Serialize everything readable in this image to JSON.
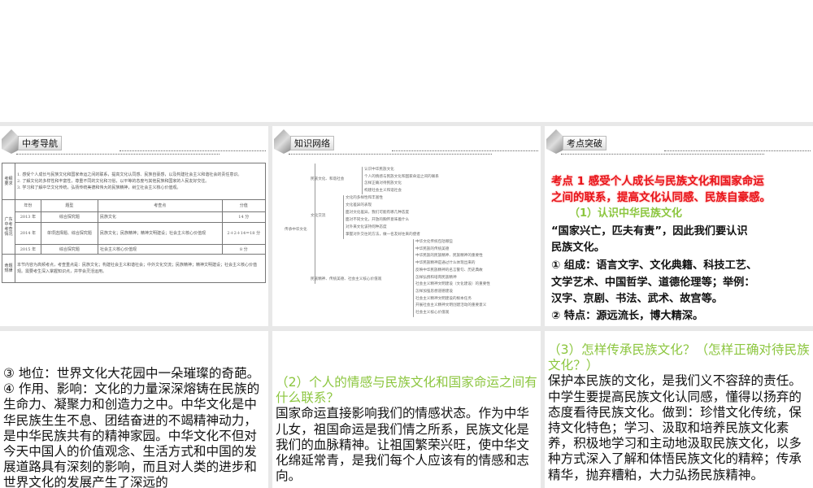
{
  "slide1": {
    "header": "中考导航",
    "req_label": "考纲要求",
    "requirements": [
      "1. 感受个人成长与民族文化和国家命运之间的联系，提高文化认同感、民族自豪感，以及构建社会主义和谐社会的责任意识。",
      "2. 了解文化的多样性和丰富性，尊重不同的文化和习俗，以平等的态度与其他民族和国家的人民友好交往。",
      "3. 学习和了解中华文化传统，弘扬传统美德和伟大的民族精神，树立社会主义核心价值观。"
    ],
    "exam_label": "广东中考考查情况",
    "columns": [
      "年份",
      "题型",
      "考查点",
      "分值"
    ],
    "rows": [
      [
        "2013 年",
        "综合探究题",
        "民族文化",
        "14 分"
      ],
      [
        "2014 年",
        "单项选择题、综合探究题",
        "民族文化；民族精神；精神文明建设；社会主义核心价值观",
        "2＋2＋14＝18 分"
      ],
      [
        "2015 年",
        "综合探究题",
        "社会主义核心价值观",
        "8 分"
      ]
    ],
    "rule_label": "命题规律",
    "rule": "本节内容为高频考点，考查重点是：民族文化；构建社会主义和谐社会；中外文化交流；民族精神；精神文明建设；社会主义核心价值观。需要考生深入掌握知识点，并学会灵活运用。"
  },
  "slide2": {
    "header": "知识网络",
    "root": "传承中华文化",
    "branches": [
      {
        "label": "民族文化、和谐社会",
        "items": [
          "认识中华民族文化",
          "个人的情感与民族文化和国家命运之间的联系",
          "怎样正确对待民族文化",
          "构建社会主义和谐社会"
        ]
      },
      {
        "label": "文化交流",
        "items": [
          "文化的多样性和丰富性",
          "文化差异的表现",
          "面对文化差异，我们可能有哪几种态度",
          "面对不同文化，开放的胸怀意味着什么",
          "对外来文化该持何种态度",
          "掌握对外交往的方法，做一名友好往来的使者"
        ]
      },
      {
        "label": "民族精神、传统美德、社会主义核心价值观",
        "items": [
          "中华文化传统包括哪些",
          "中华民族的传统美德",
          "中华民族的民族精神、民族精神的重要性",
          "中华民族精神是通过什么体现出来的",
          "反映中华民族精神的名言警句、历史典故",
          "怎样弘扬和培育民族精神",
          "社会主义精神文明建设（文化建设）的重要性",
          "怎样加强思想道德建设",
          "社会主义精神文明建设的根本任务",
          "开展社会主义精神文明创建活动的重要意义",
          "社会主义核心价值观"
        ]
      }
    ]
  },
  "slide3": {
    "header": "考点突破",
    "topic": [
      "考点 1 感受个人成长与民族文化和国家命运",
      "之间的联系，提高文化认同感、民族自豪感。"
    ],
    "subhead": "（1）认识中华民族文化",
    "lines": [
      "“国家兴亡，匹夫有责”，因此我们要认识",
      "民族文化。",
      "① 组成：语言文字、文化典籍、科技工艺、",
      "文学艺术、中国哲学、道德伦理等；举例：",
      "汉字、京剧、书法、武术、故宫等。",
      "② 特点：源远流长，博大精深。"
    ]
  },
  "slide4": {
    "text": "③ 地位：世界文化大花园中一朵璀璨的奇葩。④ 作用、影响：文化的力量深深熔铸在民族的生命力、凝聚力和创造力之中。中华文化是中华民族生生不息、团结奋进的不竭精神动力，是中华民族共有的精神家园。中华文化不但对今天中国人的价值观念、生活方式和中国的发展道路具有深刻的影响，而且对人类的进步和世界文化的发展产生了深远的"
  },
  "slide5": {
    "heading": "（2）个人的情感与民族文化和国家命运之间有什么联系？",
    "text": "国家命运直接影响我们的情感状态。作为中华儿女，祖国命运是我们情之所系，民族文化是我们的血脉精神。让祖国繁荣兴旺，使中华文化绵延常青，是我们每个人应该有的情感和志向。"
  },
  "slide6": {
    "heading": "（3）怎样传承民族文化？（怎样正确对待民族文化？）",
    "text": "保护本民族的文化，是我们义不容辞的责任。中学生要提高民族文化认同感，懂得以扬弃的态度看待民族文化。做到：珍惜文化传统，保持文化特色；学习、汲取和培养民族文化素养，积极地学习和主动地汲取民族文化，以多种方式深入了解和体悟民族文化的精粹；传承精华，抛弃糟粕，大力弘扬民族精神。"
  },
  "colors": {
    "red": "#e8141a",
    "green": "#8cc63f",
    "gap": "#e8e8e8"
  }
}
